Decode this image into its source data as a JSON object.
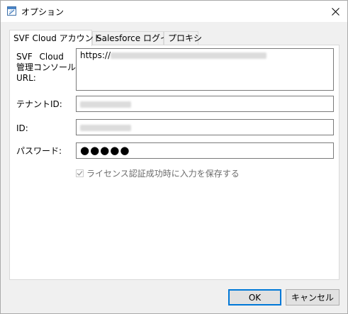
{
  "window": {
    "title": "オプション",
    "icon": "app-window-icon",
    "close_icon": "close-icon"
  },
  "tabs": [
    {
      "label": "SVF Cloud アカウント",
      "active": true
    },
    {
      "label": "Salesforce ログイン",
      "active": false
    },
    {
      "label": "プロキシ",
      "active": false
    }
  ],
  "form": {
    "url_label_line1": "SVF Cloud",
    "url_label_line2": "管理コンソール",
    "url_label_line3": "URL:",
    "url_value_prefix": "https://",
    "tenant_label": "テナントID:",
    "id_label": "ID:",
    "password_label": "パスワード:",
    "password_value": "●●●●●",
    "remember_checked": true,
    "remember_label": "ライセンス認証成功時に入力を保存する"
  },
  "buttons": {
    "ok": "OK",
    "cancel": "キャンセル"
  },
  "colors": {
    "accent": "#0078d7",
    "panel_bg": "#ffffff",
    "window_bg": "#f0f0f0",
    "disabled_text": "#6d6d6d"
  }
}
